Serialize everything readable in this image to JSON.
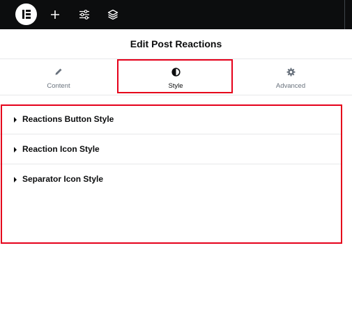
{
  "topbar": {
    "logo_icon": "elementor-logo-icon",
    "buttons": [
      {
        "icon": "plus-icon"
      },
      {
        "icon": "sliders-icon"
      },
      {
        "icon": "layers-icon"
      }
    ]
  },
  "panel": {
    "title": "Edit Post Reactions"
  },
  "tabs": [
    {
      "label": "Content",
      "icon": "pencil-icon",
      "active": false
    },
    {
      "label": "Style",
      "icon": "half-circle-icon",
      "active": true
    },
    {
      "label": "Advanced",
      "icon": "gear-icon",
      "active": false
    }
  ],
  "sections": [
    {
      "label": "Reactions Button Style"
    },
    {
      "label": "Reaction Icon Style"
    },
    {
      "label": "Separator Icon Style"
    }
  ],
  "colors": {
    "topbar_bg": "#0c0d0e",
    "highlight": "#e5001a",
    "muted_text": "#69727d",
    "border": "#e6e8ea"
  }
}
